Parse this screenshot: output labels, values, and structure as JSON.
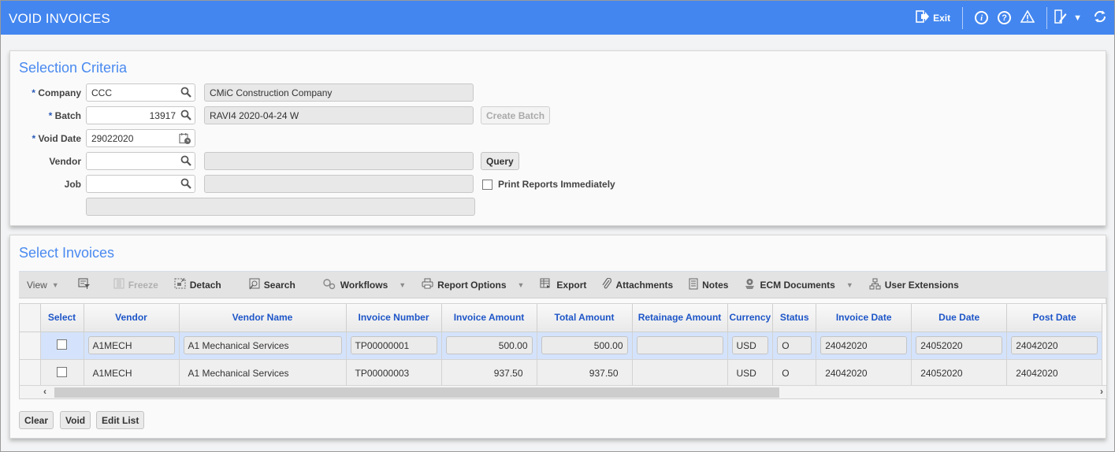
{
  "header": {
    "title": "VOID INVOICES",
    "exit_label": "Exit",
    "icons": [
      "exit-icon",
      "info-icon",
      "help-icon",
      "warning-icon",
      "edit-icon",
      "dropdown-caret-icon",
      "refresh-icon"
    ]
  },
  "selection_criteria": {
    "title": "Selection Criteria",
    "company": {
      "label": "Company",
      "required": "*",
      "value": "CCC",
      "description": "CMiC Construction Company"
    },
    "batch": {
      "label": "Batch",
      "required": "*",
      "value": "13917",
      "description": "RAVI4 2020-04-24 W"
    },
    "void_date": {
      "label": "Void Date",
      "required": "*",
      "value": "29022020"
    },
    "vendor": {
      "label": "Vendor",
      "value": "",
      "description": ""
    },
    "job": {
      "label": "Job",
      "value": "",
      "description": ""
    },
    "extra_field": "",
    "create_batch_label": "Create Batch",
    "query_label": "Query",
    "print_reports_label": "Print Reports Immediately",
    "print_reports_checked": false
  },
  "select_invoices": {
    "title": "Select Invoices",
    "toolbar": {
      "view": "View",
      "freeze": "Freeze",
      "detach": "Detach",
      "search": "Search",
      "workflows": "Workflows",
      "report_options": "Report Options",
      "export": "Export",
      "attachments": "Attachments",
      "notes": "Notes",
      "ecm_documents": "ECM Documents",
      "user_extensions": "User Extensions"
    },
    "columns": [
      "Select",
      "Vendor",
      "Vendor Name",
      "Invoice Number",
      "Invoice Amount",
      "Total Amount",
      "Retainage Amount",
      "Currency",
      "Status",
      "Invoice Date",
      "Due Date",
      "Post Date"
    ],
    "rows": [
      {
        "selected": false,
        "vendor": "A1MECH",
        "vendor_name": "A1 Mechanical Services",
        "invoice_number": "TP00000001",
        "invoice_amount": "500.00",
        "total_amount": "500.00",
        "retainage_amount": "",
        "currency": "USD",
        "status": "O",
        "invoice_date": "24042020",
        "due_date": "24052020",
        "post_date": "24042020"
      },
      {
        "selected": false,
        "vendor": "A1MECH",
        "vendor_name": "A1 Mechanical Services",
        "invoice_number": "TP00000003",
        "invoice_amount": "937.50",
        "total_amount": "937.50",
        "retainage_amount": "",
        "currency": "USD",
        "status": "O",
        "invoice_date": "24042020",
        "due_date": "24052020",
        "post_date": "24042020"
      }
    ],
    "buttons": {
      "clear": "Clear",
      "void": "Void",
      "edit_list": "Edit List"
    }
  }
}
